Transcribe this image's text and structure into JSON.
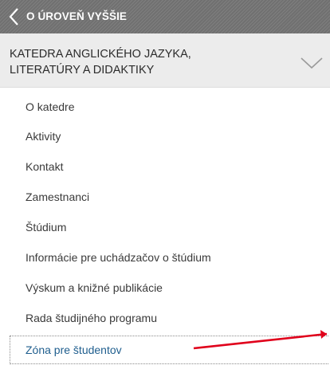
{
  "nav": {
    "back_label": "O ÚROVEŇ VYŠŠIE",
    "section_title": "KATEDRA ANGLICKÉHO JAZYKA, LITERATÚRY A DIDAKTIKY"
  },
  "menu": {
    "items": [
      {
        "label": "O katedre"
      },
      {
        "label": "Aktivity"
      },
      {
        "label": "Kontakt"
      },
      {
        "label": "Zamestnanci"
      },
      {
        "label": "Štúdium"
      },
      {
        "label": "Informácie pre uchádzačov o štúdium"
      },
      {
        "label": "Výskum a knižné publikácie"
      },
      {
        "label": "Rada študijného programu"
      },
      {
        "label": "Zóna pre študentov"
      }
    ],
    "active_index": 8
  },
  "colors": {
    "back_bar": "#707070",
    "section_bg": "#ececec",
    "active_text": "#1f5e8e",
    "annotation_arrow": "#e0001b"
  }
}
